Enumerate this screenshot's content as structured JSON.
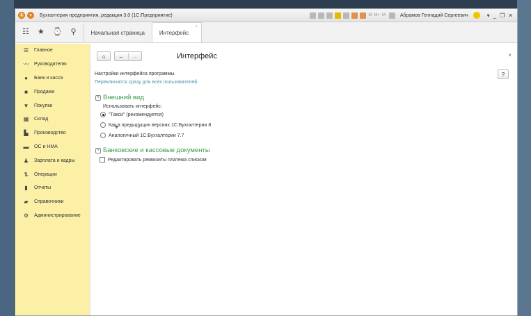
{
  "window": {
    "title": "Бухгалтерия предприятия, редакция 3.0  (1С:Предприятие)",
    "user": "Абрамов Геннадий Сергеевич",
    "mem_labels": [
      "M",
      "M+",
      "M-"
    ]
  },
  "tabs": [
    {
      "label": "Начальная страница",
      "active": false
    },
    {
      "label": "Интерфейс",
      "active": true
    }
  ],
  "sidebar": {
    "items": [
      {
        "label": "Главное",
        "icon": "menu-icon"
      },
      {
        "label": "Руководителю",
        "icon": "chart-line-icon"
      },
      {
        "label": "Банк и касса",
        "icon": "coin-icon"
      },
      {
        "label": "Продажи",
        "icon": "bag-icon"
      },
      {
        "label": "Покупки",
        "icon": "cart-icon"
      },
      {
        "label": "Склад",
        "icon": "warehouse-icon"
      },
      {
        "label": "Производство",
        "icon": "factory-icon"
      },
      {
        "label": "ОС и НМА",
        "icon": "truck-icon"
      },
      {
        "label": "Зарплата и кадры",
        "icon": "person-icon"
      },
      {
        "label": "Операции",
        "icon": "operations-icon"
      },
      {
        "label": "Отчеты",
        "icon": "bar-chart-icon"
      },
      {
        "label": "Справочники",
        "icon": "book-icon"
      },
      {
        "label": "Администрирование",
        "icon": "gear-icon"
      }
    ]
  },
  "content": {
    "title": "Интерфейс",
    "description": "Настройки интерфейса программы.",
    "note": "Переключатся сразу для всех пользователей.",
    "help_label": "?",
    "section_view": {
      "title": "Внешний вид",
      "use_label": "Использовать интерфейс:",
      "options": [
        {
          "label": "\"Такси\" (рекомендуется)",
          "selected": true
        },
        {
          "label": "Как в предыдущих версиях 1С:Бухгалтерии 8",
          "selected": false
        },
        {
          "label": "Аналогичный 1С:Бухгалтерии 7.7",
          "selected": false
        }
      ]
    },
    "section_bank": {
      "title": "Банковские и кассовые документы",
      "checkbox_label": "Редактировать реквизиты платежа списком",
      "checked": false
    }
  }
}
